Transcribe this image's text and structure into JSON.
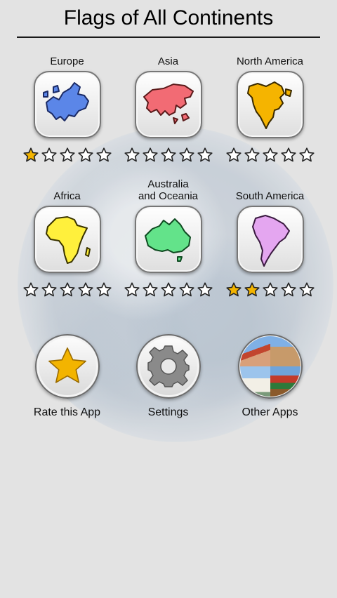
{
  "header": {
    "title": "Flags of All Continents"
  },
  "continents": [
    {
      "label": "Europe",
      "rating": 1,
      "max": 5,
      "color": "#5b86e8"
    },
    {
      "label": "Asia",
      "rating": 0,
      "max": 5,
      "color": "#f26b74"
    },
    {
      "label": "North America",
      "rating": 0,
      "max": 5,
      "color": "#f5b400"
    },
    {
      "label": "Africa",
      "rating": 0,
      "max": 5,
      "color": "#fff03c"
    },
    {
      "label_line1": "Australia",
      "label_line2": "and Oceania",
      "rating": 0,
      "max": 5,
      "color": "#63e38a"
    },
    {
      "label": "South America",
      "rating": 2,
      "max": 5,
      "color": "#e4a6f0"
    }
  ],
  "actions": {
    "rate_label": "Rate this App",
    "settings_label": "Settings",
    "other_apps_label": "Other Apps"
  },
  "icons": {
    "rate": "star-icon",
    "settings": "gear-icon",
    "other_apps": "landmarks-photo-icon"
  },
  "colors": {
    "background": "#e3e3e3",
    "star_filled": "#f3b400",
    "star_outline": "#222222"
  }
}
